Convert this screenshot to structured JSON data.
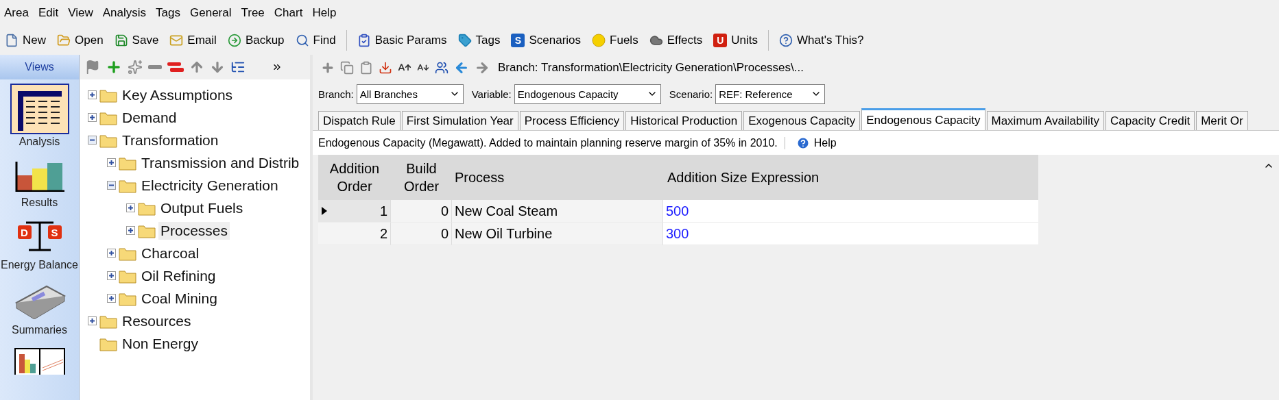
{
  "menu": [
    "Area",
    "Edit",
    "View",
    "Analysis",
    "Tags",
    "General",
    "Tree",
    "Chart",
    "Help"
  ],
  "toolbar": [
    [
      {
        "label": "New"
      },
      {
        "label": "Open"
      },
      {
        "label": "Save"
      },
      {
        "label": "Email"
      },
      {
        "label": "Backup"
      },
      {
        "label": "Find"
      }
    ],
    [
      {
        "label": "Basic Params"
      },
      {
        "label": "Tags"
      },
      {
        "label": "Scenarios",
        "glyph": "S"
      },
      {
        "label": "Fuels"
      },
      {
        "label": "Effects"
      },
      {
        "label": "Units",
        "glyph": "U"
      }
    ],
    [
      {
        "label": "What's This?"
      }
    ]
  ],
  "views": {
    "title": "Views",
    "items": [
      {
        "label": "Analysis",
        "selected": true
      },
      {
        "label": "Results",
        "selected": false
      },
      {
        "label": "Energy Balance",
        "selected": false,
        "glyphs": [
          "D",
          "S"
        ]
      },
      {
        "label": "Summaries",
        "selected": false
      },
      {
        "selected": false
      }
    ]
  },
  "tree": [
    {
      "label": "Key Assumptions",
      "expanded": false,
      "selected": false
    },
    {
      "label": "Demand",
      "expanded": false,
      "selected": false
    },
    {
      "label": "Transformation",
      "expanded": true,
      "selected": false,
      "children": [
        {
          "label": "Transmission and Distrib",
          "expanded": false,
          "selected": false
        },
        {
          "label": "Electricity Generation",
          "expanded": true,
          "selected": false,
          "children": [
            {
              "label": "Output Fuels",
              "expanded": false,
              "selected": false
            },
            {
              "label": "Processes",
              "expanded": false,
              "selected": true
            }
          ]
        },
        {
          "label": "Charcoal",
          "expanded": false,
          "selected": false
        },
        {
          "label": "Oil Refining",
          "expanded": false,
          "selected": false
        },
        {
          "label": "Coal Mining",
          "expanded": false,
          "selected": false
        }
      ]
    },
    {
      "label": "Resources",
      "expanded": false,
      "selected": false
    },
    {
      "label": "Non Energy",
      "selected": false
    }
  ],
  "breadcrumb": "Branch: Transformation\\Electricity Generation\\Processes\\...",
  "filters": [
    {
      "label": "Branch:",
      "value": "All Branches"
    },
    {
      "label": "Variable:",
      "value": "Endogenous Capacity"
    },
    {
      "label": "Scenario:",
      "value": "REF: Reference"
    }
  ],
  "tabs": [
    {
      "label": "Dispatch Rule",
      "selected": false
    },
    {
      "label": "First Simulation Year",
      "selected": false
    },
    {
      "label": "Process Efficiency",
      "selected": false
    },
    {
      "label": "Historical Production",
      "selected": false
    },
    {
      "label": "Exogenous Capacity",
      "selected": false
    },
    {
      "label": "Endogenous Capacity",
      "selected": true
    },
    {
      "label": "Maximum Availability",
      "selected": false
    },
    {
      "label": "Capacity Credit",
      "selected": false
    },
    {
      "label": "Merit Or",
      "selected": false
    }
  ],
  "info": {
    "text": "Endogenous Capacity (Megawatt).  Added to maintain planning reserve margin of 35% in 2010.",
    "help": "Help"
  },
  "table": {
    "columns": [
      {
        "label": "Addition Order",
        "kind": "number"
      },
      {
        "label": "Build Order",
        "kind": "number"
      },
      {
        "label": "Process",
        "kind": "text"
      },
      {
        "label": "Addition Size Expression",
        "kind": "expression"
      }
    ],
    "rows": [
      {
        "current": true,
        "cells": [
          "1",
          "0",
          "New Coal Steam",
          "500"
        ]
      },
      {
        "current": false,
        "cells": [
          "2",
          "0",
          "New Oil Turbine",
          "300"
        ]
      }
    ]
  }
}
